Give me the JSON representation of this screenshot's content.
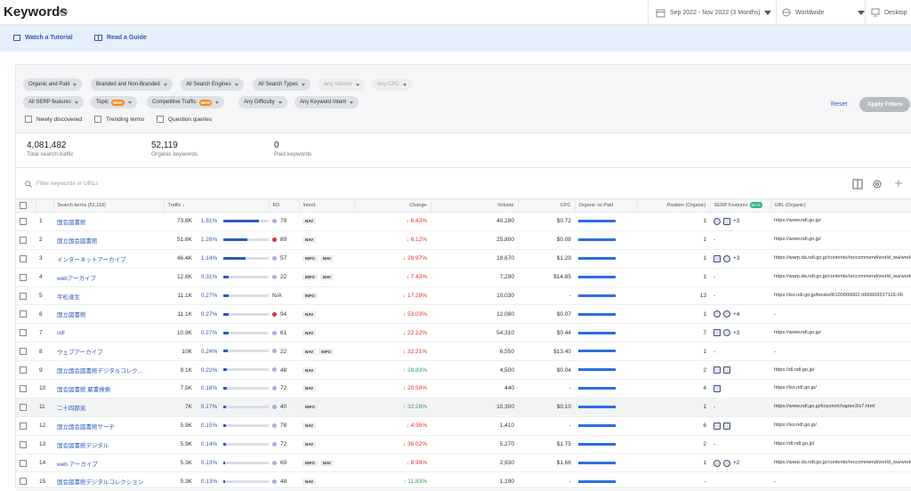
{
  "header": {
    "title": "Keywords",
    "date_range": "Sep 2022 - Nov 2022 (3 Months)",
    "region": "Worldwide",
    "device": "Desktop"
  },
  "tutorial": {
    "watch": "Watch a Tutorial",
    "guide": "Read a Guide"
  },
  "filters": {
    "row1": [
      "Organic and Paid",
      "Branded and Non-Branded",
      "All Search Engines",
      "All Search Types",
      "Any Volume",
      "Any CPC"
    ],
    "row2": [
      "All SERP features",
      "Topic",
      "Competitive Traffic",
      "Any Difficulty",
      "Any Keyword Intent"
    ],
    "new_badge": "NEW",
    "checks": [
      "Newly discovered",
      "Trending terms",
      "Question queries"
    ],
    "reset": "Reset",
    "apply": "Apply Filters"
  },
  "stats": [
    {
      "value": "4,081,482",
      "label": "Total search traffic"
    },
    {
      "value": "52,119",
      "label": "Organic keywords"
    },
    {
      "value": "0",
      "label": "Paid keywords"
    }
  ],
  "search": {
    "placeholder": "Filter keywords or URLs"
  },
  "table": {
    "headers": {
      "search_terms": "Search terms (52,119)",
      "traffic": "Traffic",
      "kd": "KD",
      "intent": "Intent",
      "change": "Change",
      "volume": "Volume",
      "cpc": "CPC",
      "ovp": "Organic vs Paid",
      "position": "Position (Organic)",
      "serp": "SERP Features",
      "serp_badge": "BETA",
      "url": "URL (Organic)"
    },
    "rows": [
      {
        "n": "1",
        "kw": "国会図書館",
        "traffic": "73.8K",
        "pct": "1.81%",
        "share": 1.81,
        "kd": "79",
        "kdc": "#9db5da",
        "intent": [
          "NAV"
        ],
        "change": "6.43%",
        "dir": "down",
        "vol": "40,180",
        "cpc": "$0.72",
        "pos": "1",
        "serp": [
          "clock",
          "book"
        ],
        "more": "+3",
        "url": "https://www.ndl.go.jp/"
      },
      {
        "n": "2",
        "kw": "国立国会図書館",
        "traffic": "51.6K",
        "pct": "1.26%",
        "share": 1.26,
        "kd": "89",
        "kdc": "#d9342b",
        "intent": [
          "NAV"
        ],
        "change": "6.12%",
        "dir": "down",
        "vol": "25,800",
        "cpc": "$0.08",
        "pos": "1",
        "serp": [],
        "more": "-",
        "url": "https://www.ndl.go.jp/"
      },
      {
        "n": "3",
        "kw": "インターネットアーカイブ",
        "traffic": "46.4K",
        "pct": "1.14%",
        "share": 1.14,
        "kd": "57",
        "kdc": "#9db5da",
        "intent": [
          "INFO",
          "NAV"
        ],
        "change": "28.97%",
        "dir": "down",
        "vol": "18,670",
        "cpc": "$1.29",
        "pos": "1",
        "serp": [
          "img",
          "clock"
        ],
        "more": "+3",
        "url": "https://warp.da.ndl.go.jp/contents/reccommend/world_wa/world_wa02.html"
      },
      {
        "n": "4",
        "kw": "webアーカイブ",
        "traffic": "12.6K",
        "pct": "0.31%",
        "share": 0.31,
        "kd": "22",
        "kdc": "#9db5da",
        "intent": [
          "INFO",
          "NAV"
        ],
        "change": "7.43%",
        "dir": "down",
        "vol": "7,290",
        "cpc": "$14.85",
        "pos": "1",
        "serp": [],
        "more": "-",
        "url": "https://warp.da.ndl.go.jp/contents/reccommend/world_wa/world_wa02.html"
      },
      {
        "n": "5",
        "kw": "平松達生",
        "traffic": "11.1K",
        "pct": "0.27%",
        "share": 0.27,
        "kd": "N/A",
        "kdc": "",
        "intent": [
          "INFO"
        ],
        "change": "17.29%",
        "dir": "down",
        "vol": "10,030",
        "cpc": "-",
        "pos": "13",
        "serp": [],
        "more": "-",
        "url": "https://iss.ndl.go.jp/books/R100000002-I000009317116-00"
      },
      {
        "n": "6",
        "kw": "国立図書館",
        "traffic": "11.1K",
        "pct": "0.27%",
        "share": 0.27,
        "kd": "94",
        "kdc": "#d9342b",
        "intent": [
          "NAV"
        ],
        "change": "53.03%",
        "dir": "down",
        "vol": "12,080",
        "cpc": "$0.07",
        "pos": "1",
        "serp": [
          "pin",
          "clock"
        ],
        "more": "+4",
        "url": "-"
      },
      {
        "n": "7",
        "kw": "ndl",
        "traffic": "10.9K",
        "pct": "0.27%",
        "share": 0.27,
        "kd": "61",
        "kdc": "#9db5da",
        "intent": [
          "NAV"
        ],
        "change": "22.12%",
        "dir": "down",
        "vol": "54,310",
        "cpc": "$0.44",
        "pos": "7",
        "serp": [
          "img",
          "clock"
        ],
        "more": "+3",
        "url": "https://www.ndl.go.jp/"
      },
      {
        "n": "8",
        "kw": "ウェブアーカイブ",
        "traffic": "10K",
        "pct": "0.24%",
        "share": 0.24,
        "kd": "22",
        "kdc": "#9db5da",
        "intent": [
          "NAV",
          "INFO"
        ],
        "change": "32.21%",
        "dir": "down",
        "vol": "6,550",
        "cpc": "$13.40",
        "pos": "1",
        "serp": [],
        "more": "-",
        "url": "-"
      },
      {
        "n": "9",
        "kw": "国立国会図書館デジタルコレク...",
        "traffic": "9.1K",
        "pct": "0.22%",
        "share": 0.22,
        "kd": "48",
        "kdc": "#9db5da",
        "intent": [
          "NAV"
        ],
        "change": "28.83%",
        "dir": "up",
        "vol": "4,500",
        "cpc": "$0.04",
        "pos": "2",
        "serp": [
          "img",
          "chat"
        ],
        "more": "",
        "url": "https://dl.ndl.go.jp/"
      },
      {
        "n": "10",
        "kw": "国会図書館 蔵書検索",
        "traffic": "7.5K",
        "pct": "0.18%",
        "share": 0.18,
        "kd": "72",
        "kdc": "#9db5da",
        "intent": [
          "NAV"
        ],
        "change": "20.59%",
        "dir": "down",
        "vol": "440",
        "cpc": "-",
        "pos": "4",
        "serp": [
          "chat"
        ],
        "more": "",
        "url": "https://iss.ndl.go.jp/"
      },
      {
        "n": "11",
        "kw": "二十四節気",
        "traffic": "7K",
        "pct": "0.17%",
        "share": 0.17,
        "kd": "40",
        "kdc": "#9db5da",
        "intent": [
          "INFO"
        ],
        "change": "32.28%",
        "dir": "up",
        "vol": "10,300",
        "cpc": "$0.10",
        "pos": "1",
        "serp": [],
        "more": "-",
        "url": "https://www.ndl.go.jp/koyomi/chapter3/s7.html"
      },
      {
        "n": "12",
        "kw": "国立国会図書館サーチ",
        "traffic": "5.9K",
        "pct": "0.15%",
        "share": 0.15,
        "kd": "78",
        "kdc": "#9db5da",
        "intent": [
          "NAV"
        ],
        "change": "4.95%",
        "dir": "down",
        "vol": "1,410",
        "cpc": "-",
        "pos": "6",
        "serp": [
          "img",
          "chat"
        ],
        "more": "",
        "url": "https://iss.ndl.go.jp/"
      },
      {
        "n": "13",
        "kw": "国会図書館デジタル",
        "traffic": "5.9K",
        "pct": "0.14%",
        "share": 0.14,
        "kd": "72",
        "kdc": "#9db5da",
        "intent": [
          "NAV"
        ],
        "change": "36.02%",
        "dir": "down",
        "vol": "5,270",
        "cpc": "$1.75",
        "pos": "2",
        "serp": [],
        "more": "-",
        "url": "https://dl.ndl.go.jp/"
      },
      {
        "n": "14",
        "kw": "web アーカイブ",
        "traffic": "5.3K",
        "pct": "0.13%",
        "share": 0.13,
        "kd": "69",
        "kdc": "#9db5da",
        "intent": [
          "INFO",
          "NAV"
        ],
        "change": "8.99%",
        "dir": "down",
        "vol": "2,930",
        "cpc": "$1.66",
        "pos": "1",
        "serp": [
          "clock",
          "gear"
        ],
        "more": "+2",
        "url": "https://warp.da.ndl.go.jp/contents/reccommend/world_wa/world_wa02.html"
      },
      {
        "n": "15",
        "kw": "国会図書館デジタルコレクション",
        "traffic": "5.3K",
        "pct": "0.13%",
        "share": 0.13,
        "kd": "48",
        "kdc": "#9db5da",
        "intent": [
          "NAV"
        ],
        "change": "11.83%",
        "dir": "up",
        "vol": "1,190",
        "cpc": "-",
        "pos": "-",
        "serp": [],
        "more": "",
        "url": "-"
      }
    ]
  }
}
